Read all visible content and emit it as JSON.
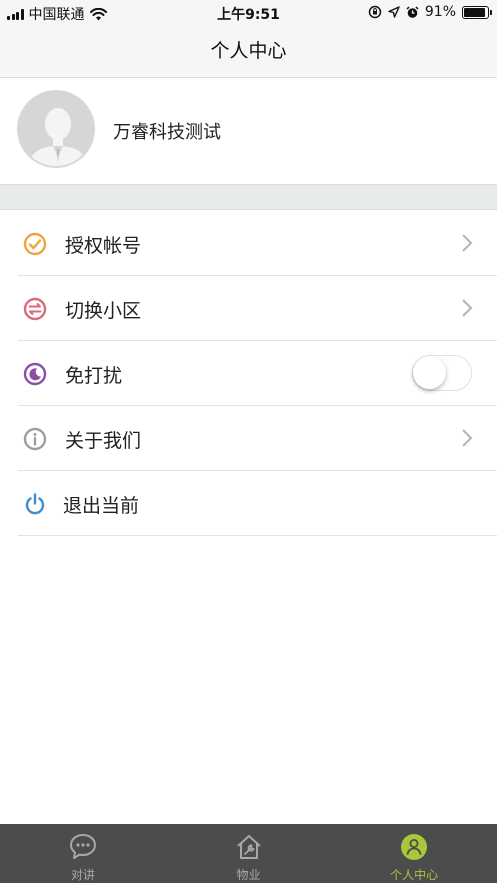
{
  "status_bar": {
    "carrier": "中国联通",
    "time": "上午9:51",
    "battery_text": "91%",
    "battery_level": 0.91,
    "icons": [
      "signal-icon",
      "wifi-icon",
      "rotation-lock-icon",
      "location-icon",
      "alarm-icon",
      "battery-icon"
    ]
  },
  "nav": {
    "title": "个人中心"
  },
  "profile": {
    "name": "万睿科技测试",
    "avatar_icon": "user-avatar-icon"
  },
  "menu": {
    "items": [
      {
        "label": "授权帐号",
        "icon": "check-circle-icon",
        "color": "#f0a33a",
        "accessory": "chevron"
      },
      {
        "label": "切换小区",
        "icon": "switch-arrows-icon",
        "color": "#d96a7e",
        "accessory": "chevron"
      },
      {
        "label": "免打扰",
        "icon": "moon-icon",
        "color": "#8a4fa3",
        "accessory": "toggle",
        "toggle_on": false
      },
      {
        "label": "关于我们",
        "icon": "info-icon",
        "color": "#9e9e9e",
        "accessory": "chevron"
      },
      {
        "label": "退出当前",
        "icon": "power-icon",
        "color": "#3d8fd1",
        "accessory": "none"
      }
    ]
  },
  "tab_bar": {
    "tabs": [
      {
        "label": "对讲",
        "icon": "chat-bubble-icon",
        "active": false
      },
      {
        "label": "物业",
        "icon": "house-wrench-icon",
        "active": false
      },
      {
        "label": "个人中心",
        "icon": "person-icon",
        "active": true
      }
    ],
    "active_color": "#a8c73a",
    "inactive_color": "#a8a8a8"
  }
}
